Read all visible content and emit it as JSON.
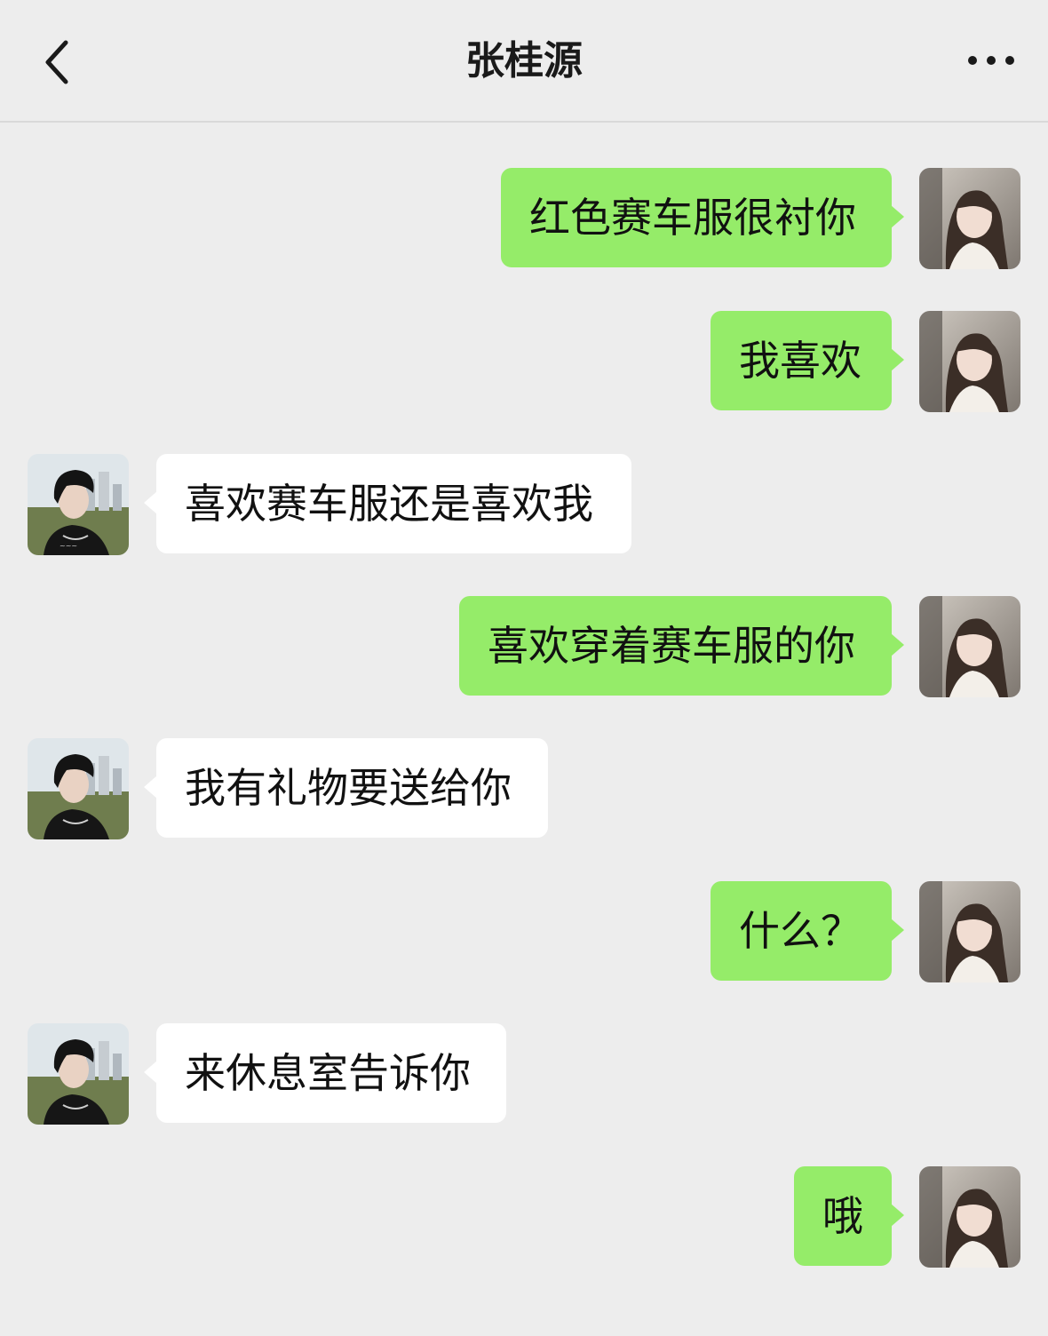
{
  "header": {
    "title": "张桂源",
    "back_icon": "chevron-left-icon",
    "more_icon": "more-horizontal-icon"
  },
  "colors": {
    "background": "#ededed",
    "outgoing_bubble": "#95ec69",
    "incoming_bubble": "#ffffff"
  },
  "messages": [
    {
      "from": "me",
      "text": "红色赛车服很衬你"
    },
    {
      "from": "me",
      "text": "我喜欢"
    },
    {
      "from": "contact",
      "text": "喜欢赛车服还是喜欢我"
    },
    {
      "from": "me",
      "text": "喜欢穿着赛车服的你"
    },
    {
      "from": "contact",
      "text": "我有礼物要送给你"
    },
    {
      "from": "me",
      "text": "什么？"
    },
    {
      "from": "contact",
      "text": "来休息室告诉你"
    },
    {
      "from": "me",
      "text": "哦"
    }
  ]
}
